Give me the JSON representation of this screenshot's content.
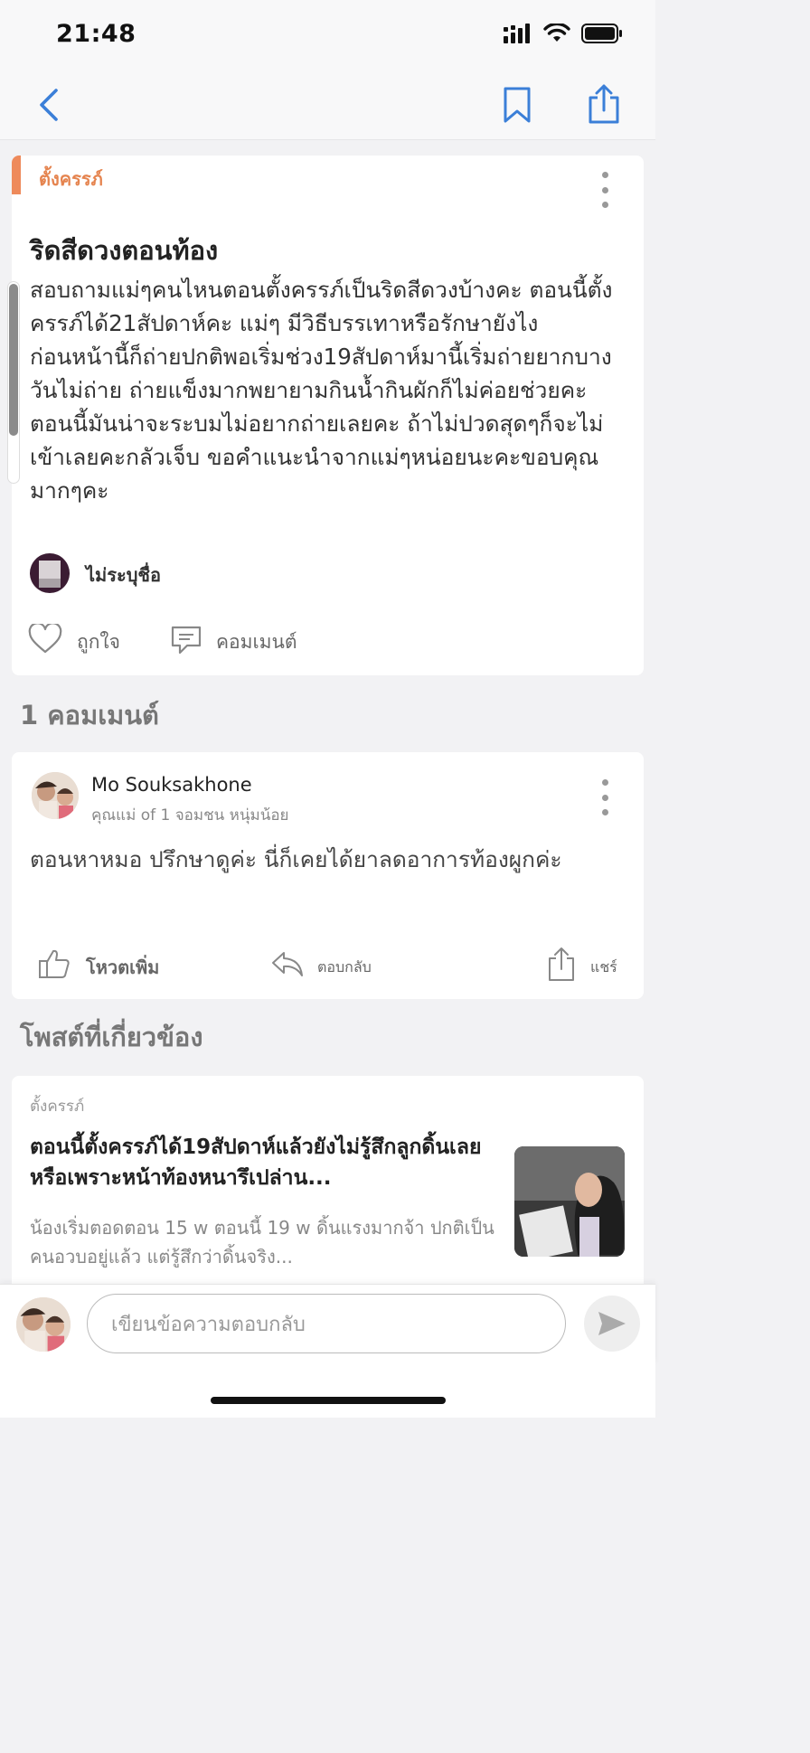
{
  "status_bar": {
    "time": "21:48"
  },
  "colors": {
    "accent": "#e5844f",
    "link_blue": "#3b7fd8"
  },
  "icons": {
    "back": "chevron-left-icon",
    "bookmark": "bookmark-icon",
    "share": "share-icon",
    "more": "more-vertical-icon",
    "like": "heart-icon",
    "comment": "comment-bubble-icon",
    "vote": "thumbs-up-icon",
    "reply": "reply-arrow-icon",
    "send": "send-icon"
  },
  "post": {
    "tag": "ตั้งครรภ์",
    "title": "ริดสีดวงตอนท้อง",
    "body": "สอบถามแม่ๆคนไหนตอนตั้งครรภ์เป็นริดสีดวงบ้างคะ ตอนนี้ตั้งครรภ์ได้21สัปดาห์คะ แม่ๆ มีวิธีบรรเทาหรือรักษายังไง\nก่อนหน้านี้ก็ถ่ายปกติพอเริ่มช่วง19สัปดาห์มานี้เริ่มถ่ายยากบางวันไม่ถ่าย ถ่ายแข็งมากพยายามกินน้ำกินผักก็ไม่ค่อยช่วยคะ ตอนนี้มันน่าจะระบมไม่อยากถ่ายเลยคะ ถ้าไม่ปวดสุดๆก็จะไม่เข้าเลยคะกลัวเจ็บ ขอคำแนะนำจากแม่ๆหน่อยนะคะขอบคุณมากๆคะ",
    "author": "ไม่ระบุชื่อ",
    "like_label": "ถูกใจ",
    "comment_label": "คอมเมนต์"
  },
  "comments_heading": "1 คอมเมนต์",
  "comment": {
    "author": "Mo Souksakhone",
    "subtitle": "คุณแม่ of 1 จอมชน หนุ่มน้อย",
    "text": "ตอนหาหมอ ปรึกษาดูค่ะ นี่ก็เคยได้ยาลดอาการท้องผูกค่ะ",
    "vote_label": "โหวตเพิ่ม",
    "reply_label": "ตอบกลับ",
    "share_label": "แชร์"
  },
  "related_heading": "โพสต์ที่เกี่ยวข้อง",
  "related": {
    "tag": "ตั้งครรภ์",
    "title": "ตอนนี้ตั้งครรภ์ได้19สัปดาห์แล้วยังไม่รู้สึกลูกดิ้นเลยหรือเพราะหน้าท้องหนารึเปล่าน...",
    "excerpt": "น้องเริ่มตอดตอน 15 w ตอนนี้ 19 w ดิ้นแรงมากจ้า ปกติเป็นคนอวบอยู่แล้ว แต่รู้สึกว่าดิ้นจริง..."
  },
  "reply_bar": {
    "placeholder": "เขียนข้อความตอบกลับ"
  }
}
